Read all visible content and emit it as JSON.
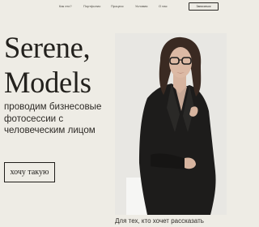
{
  "nav": {
    "items": [
      {
        "label": "Как это?"
      },
      {
        "label": "Портфолио"
      },
      {
        "label": "Процесс"
      },
      {
        "label": "Условия"
      },
      {
        "label": "О нас"
      }
    ],
    "contact_label": "Записаться"
  },
  "hero": {
    "title_line1": "Serene,",
    "title_line2": "Models",
    "subtitle": "проводим бизнесовые фотосессии с человеческим лицом",
    "cta_label": "хочу такую",
    "caption": "Для тех, кто хочет рассказать"
  }
}
